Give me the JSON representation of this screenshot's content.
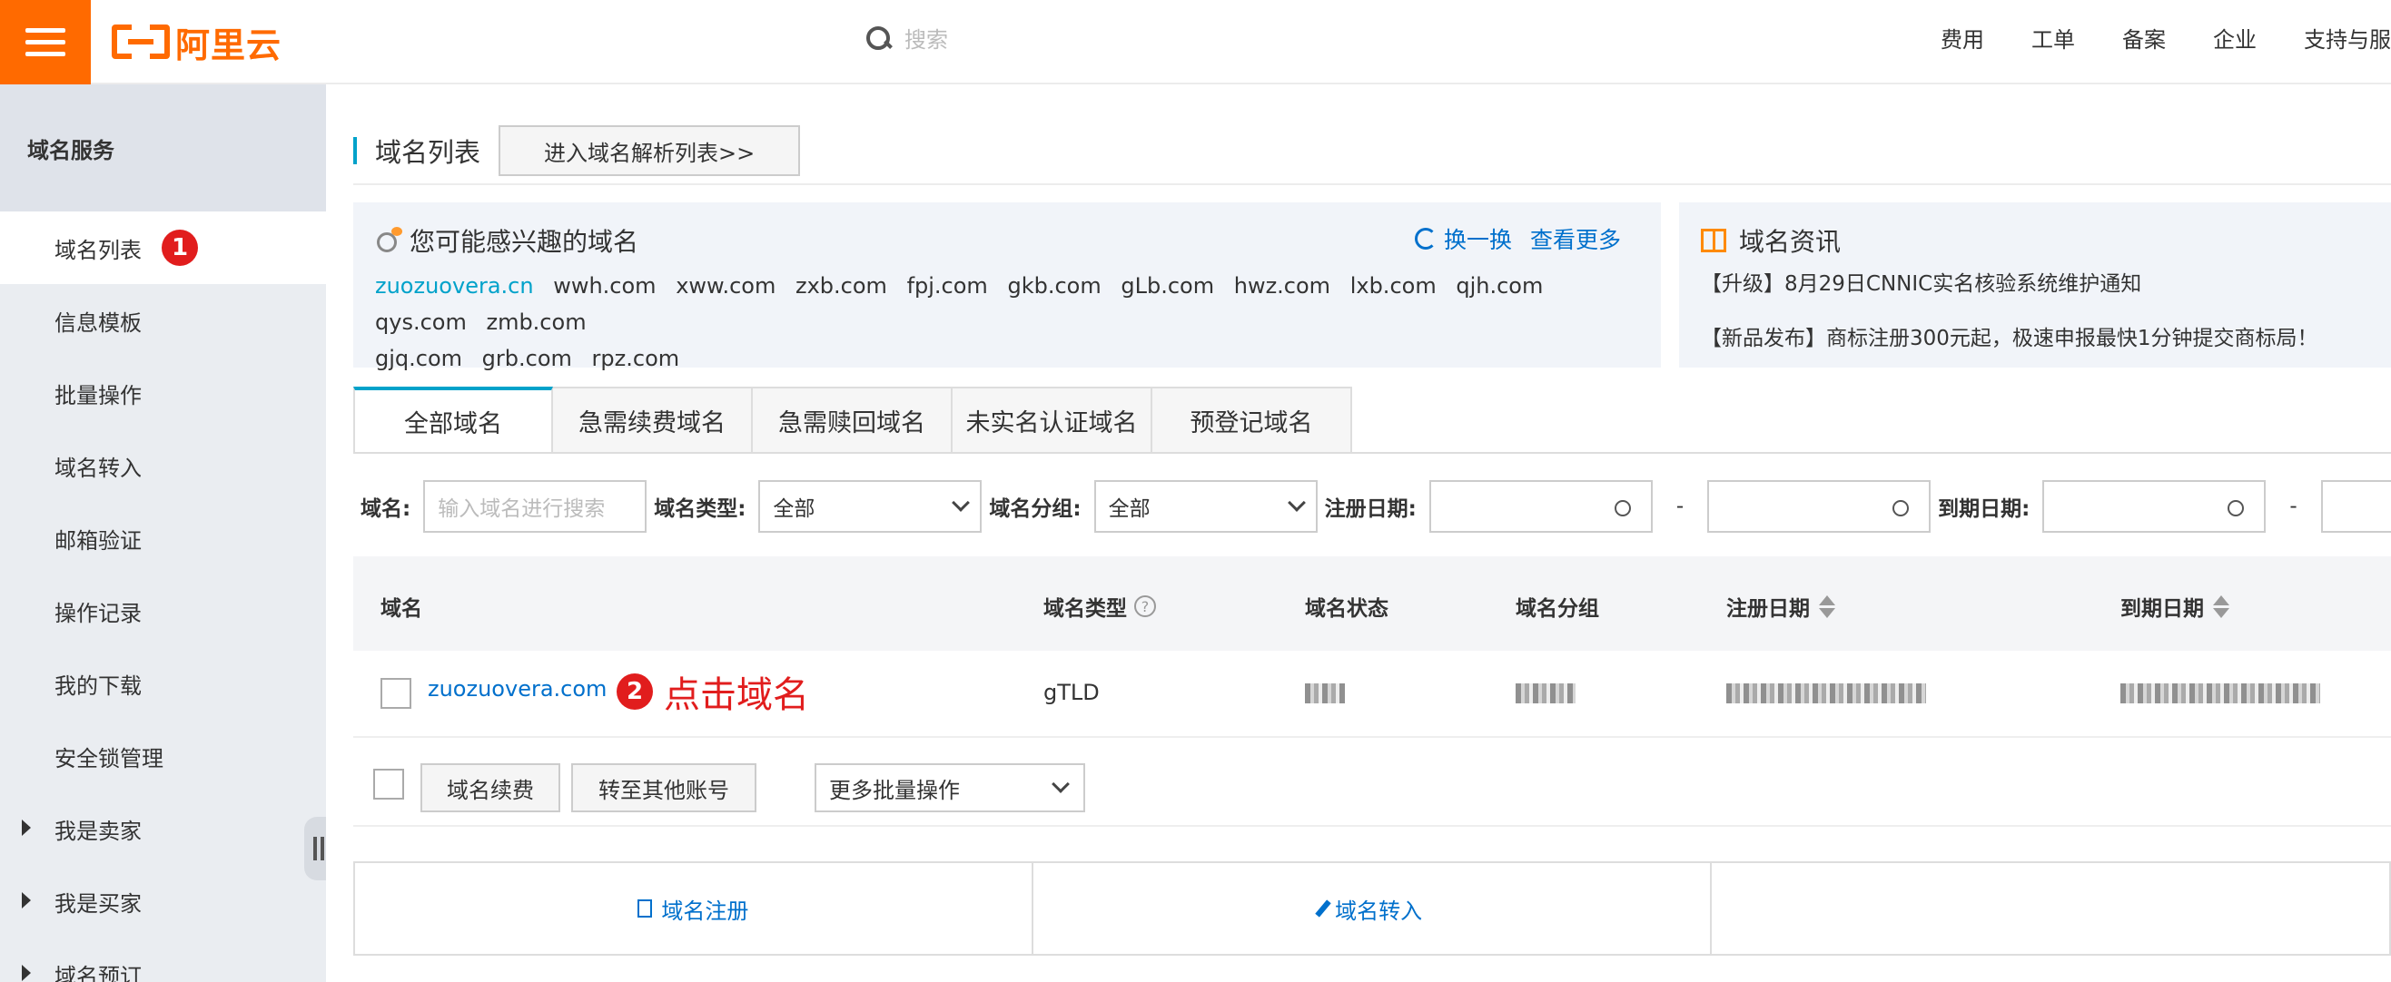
{
  "header": {
    "logo_text": "阿里云",
    "search_placeholder": "搜索",
    "nav": [
      "费用",
      "工单",
      "备案",
      "企业",
      "支持与服"
    ]
  },
  "sidebar": {
    "section_title": "域名服务",
    "items": [
      {
        "label": "域名列表",
        "active": true,
        "badge": "1"
      },
      {
        "label": "信息模板"
      },
      {
        "label": "批量操作"
      },
      {
        "label": "域名转入"
      },
      {
        "label": "邮箱验证"
      },
      {
        "label": "操作记录"
      },
      {
        "label": "我的下载"
      },
      {
        "label": "安全锁管理"
      },
      {
        "label": "我是卖家",
        "expandable": true
      },
      {
        "label": "我是买家",
        "expandable": true
      },
      {
        "label": "域名预订",
        "expandable": true
      }
    ]
  },
  "main": {
    "title": "域名列表",
    "resolve_button": "进入域名解析列表>>",
    "interest": {
      "title": "您可能感兴趣的域名",
      "refresh": "换一换",
      "more": "查看更多",
      "domains": [
        "zuozuovera.cn",
        "wwh.com",
        "xww.com",
        "zxb.com",
        "fpj.com",
        "gkb.com",
        "gLb.com",
        "hwz.com",
        "lxb.com",
        "qjh.com",
        "qys.com",
        "zmb.com",
        "gjq.com",
        "grb.com",
        "rpz.com"
      ]
    },
    "news": {
      "title": "域名资讯",
      "items": [
        "【升级】8月29日CNNIC实名核验系统维护通知",
        "【新品发布】商标注册300元起，极速申报最快1分钟提交商标局！"
      ]
    },
    "tabs": [
      "全部域名",
      "急需续费域名",
      "急需赎回域名",
      "未实名认证域名",
      "预登记域名"
    ],
    "filters": {
      "domain_label": "域名:",
      "domain_placeholder": "输入域名进行搜索",
      "type_label": "域名类型:",
      "type_value": "全部",
      "group_label": "域名分组:",
      "group_value": "全部",
      "reg_date_label": "注册日期:",
      "exp_date_label": "到期日期:",
      "dash": "-"
    },
    "table": {
      "columns": [
        "域名",
        "域名类型",
        "域名状态",
        "域名分组",
        "注册日期",
        "到期日期"
      ],
      "help_glyph": "?",
      "rows": [
        {
          "domain": "zuozuovera.com",
          "type": "gTLD"
        }
      ]
    },
    "annotation": {
      "badge": "2",
      "text": "点击域名"
    },
    "batch": {
      "renew": "域名续费",
      "transfer": "转至其他账号",
      "more": "更多批量操作"
    },
    "bottom_actions": [
      "域名注册",
      "域名转入"
    ]
  },
  "colors": {
    "brand": "#ff6a00",
    "link": "#0070cc",
    "accent": "#00a2ca",
    "annotation": "#e11d1d"
  }
}
